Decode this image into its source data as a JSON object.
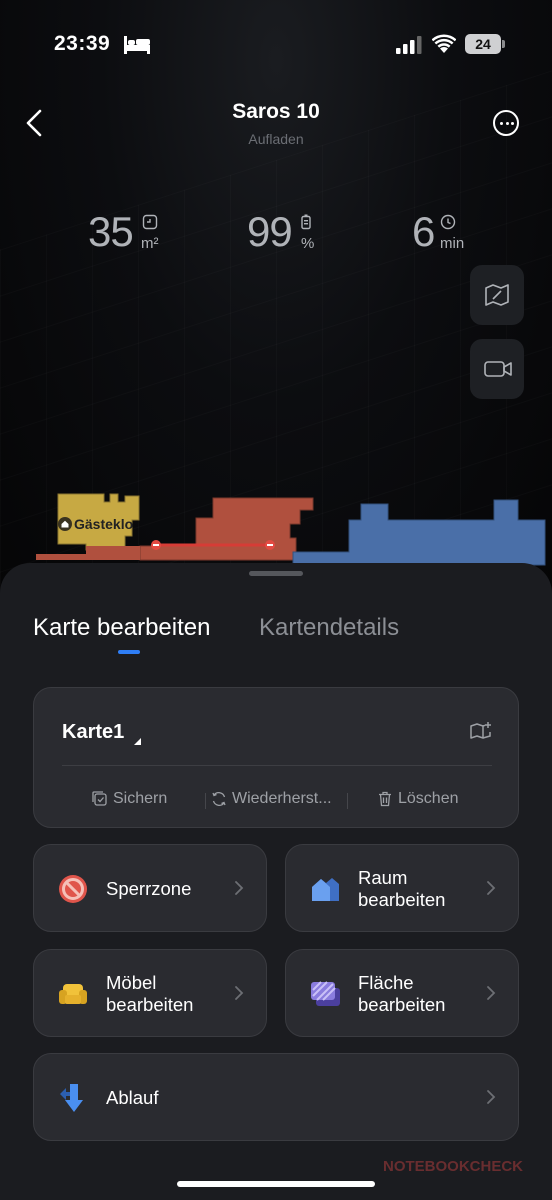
{
  "status_bar": {
    "time": "23:39",
    "battery": "24"
  },
  "header": {
    "title": "Saros 10",
    "subtitle": "Aufladen"
  },
  "stats": [
    {
      "value": "35",
      "unit": "m²",
      "icon": "area-icon"
    },
    {
      "value": "99",
      "unit": "%",
      "icon": "battery-icon"
    },
    {
      "value": "6",
      "unit": "min",
      "icon": "clock-icon"
    }
  ],
  "map": {
    "room_label": "Gästeklo"
  },
  "tabs": [
    {
      "label": "Karte bearbeiten",
      "active": true
    },
    {
      "label": "Kartendetails",
      "active": false
    }
  ],
  "map_card": {
    "name": "Karte1",
    "actions": [
      {
        "label": "Sichern",
        "icon": "save-icon"
      },
      {
        "label": "Wiederherst...",
        "icon": "restore-icon"
      },
      {
        "label": "Löschen",
        "icon": "trash-icon"
      }
    ]
  },
  "tiles": [
    {
      "label_lines": [
        "Sperrzone"
      ],
      "icon": "no-entry-icon"
    },
    {
      "label_lines": [
        "Raum",
        "bearbeiten"
      ],
      "icon": "room-icon"
    },
    {
      "label_lines": [
        "Möbel",
        "bearbeiten"
      ],
      "icon": "sofa-icon"
    },
    {
      "label_lines": [
        "Fläche",
        "bearbeiten"
      ],
      "icon": "area-pattern-icon"
    },
    {
      "label_lines": [
        "Ablauf"
      ],
      "icon": "sequence-icon"
    }
  ],
  "watermark": "NOTEBOOKCHECK",
  "colors": {
    "accent": "#2f7ef6",
    "sheet_bg": "#1b1c20",
    "card_bg": "#2a2b30"
  }
}
